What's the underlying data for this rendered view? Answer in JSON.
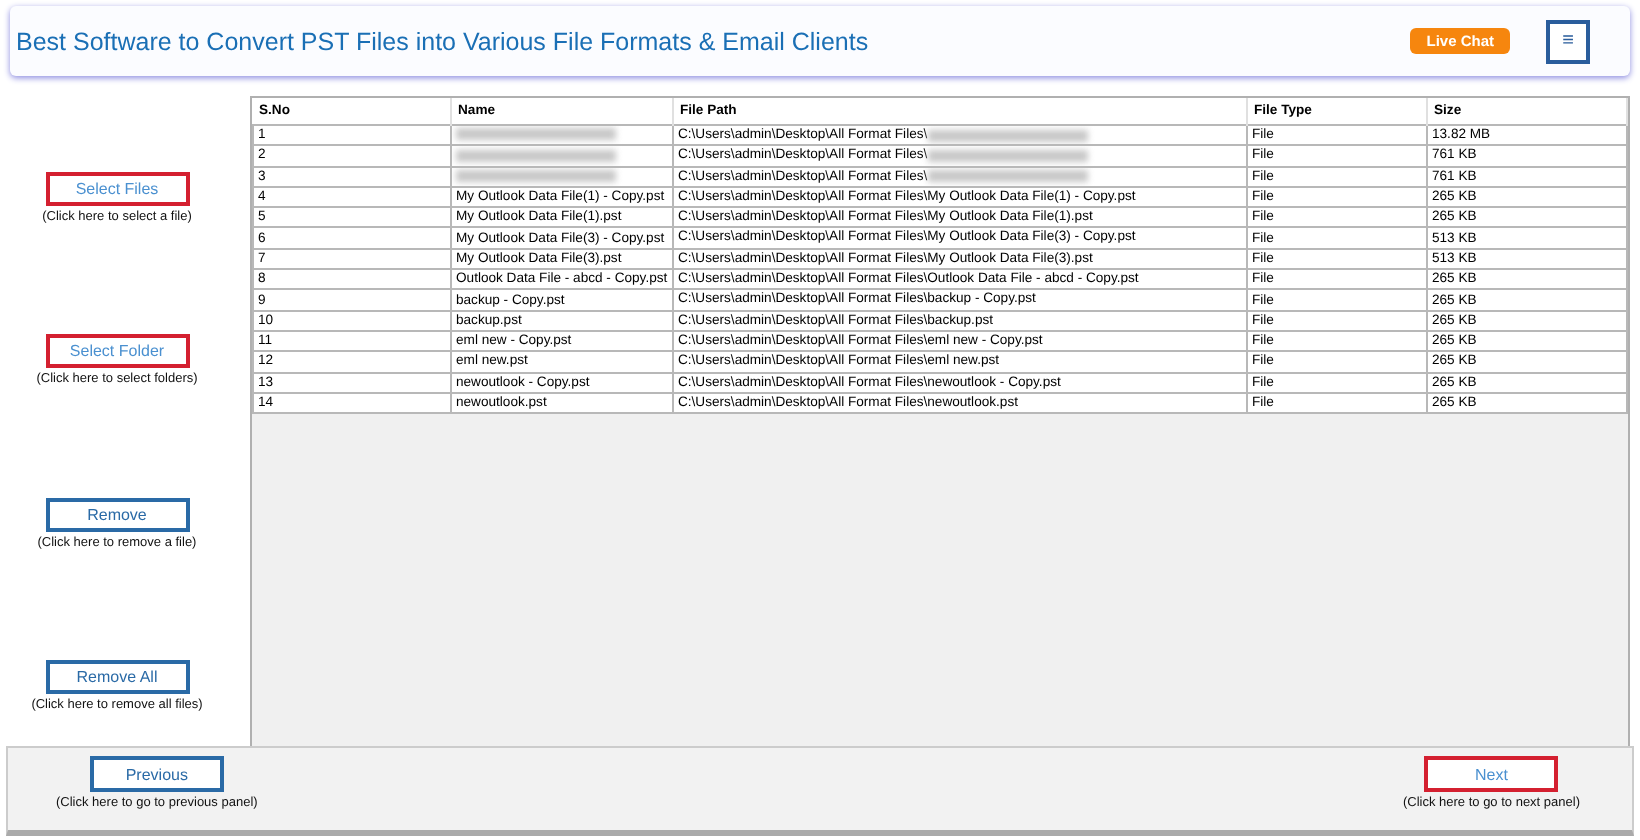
{
  "header": {
    "title": "Best Software to Convert PST Files into Various File Formats & Email Clients",
    "live_chat": "Live Chat",
    "menu": "≡"
  },
  "side_actions": [
    {
      "label": "Select Files",
      "hint": "(Click here to select a file)",
      "highlighted": true
    },
    {
      "label": "Select Folder",
      "hint": "(Click here to select folders)",
      "highlighted": true
    },
    {
      "label": "Remove",
      "hint": "(Click here to remove a file)",
      "highlighted": false
    },
    {
      "label": "Remove All",
      "hint": "(Click here to remove all files)",
      "highlighted": false
    }
  ],
  "table": {
    "columns": [
      "S.No",
      "Name",
      "File Path",
      "File Type",
      "Size"
    ],
    "rows": [
      {
        "sno": "1",
        "path": "C:\\Users\\admin\\Desktop\\All Format Files\\",
        "blurred": true,
        "type": "File",
        "size": "13.82 MB"
      },
      {
        "sno": "2",
        "path": "C:\\Users\\admin\\Desktop\\All Format Files\\",
        "blurred": true,
        "type": "File",
        "size": "761 KB"
      },
      {
        "sno": "3",
        "path": "C:\\Users\\admin\\Desktop\\All Format Files\\",
        "blurred": true,
        "type": "File",
        "size": "761 KB"
      },
      {
        "sno": "4",
        "name": "My Outlook Data File(1) - Copy.pst",
        "path": "C:\\Users\\admin\\Desktop\\All Format Files\\My Outlook Data File(1) - Copy.pst",
        "blurred": false,
        "type": "File",
        "size": "265 KB"
      },
      {
        "sno": "5",
        "name": "My Outlook Data File(1).pst",
        "path": "C:\\Users\\admin\\Desktop\\All Format Files\\My Outlook Data File(1).pst",
        "blurred": false,
        "type": "File",
        "size": "265 KB"
      },
      {
        "sno": "6",
        "name": "My Outlook Data File(3) - Copy.pst",
        "path": "C:\\Users\\admin\\Desktop\\All Format Files\\My Outlook Data File(3) - Copy.pst",
        "blurred": false,
        "type": "File",
        "size": "513 KB"
      },
      {
        "sno": "7",
        "name": "My Outlook Data File(3).pst",
        "path": "C:\\Users\\admin\\Desktop\\All Format Files\\My Outlook Data File(3).pst",
        "blurred": false,
        "type": "File",
        "size": "513 KB"
      },
      {
        "sno": "8",
        "name": "Outlook Data File - abcd - Copy.pst",
        "path": "C:\\Users\\admin\\Desktop\\All Format Files\\Outlook Data File - abcd - Copy.pst",
        "blurred": false,
        "type": "File",
        "size": "265 KB"
      },
      {
        "sno": "9",
        "name": "backup - Copy.pst",
        "path": "C:\\Users\\admin\\Desktop\\All Format Files\\backup - Copy.pst",
        "blurred": false,
        "type": "File",
        "size": "265 KB"
      },
      {
        "sno": "10",
        "name": "backup.pst",
        "path": "C:\\Users\\admin\\Desktop\\All Format Files\\backup.pst",
        "blurred": false,
        "type": "File",
        "size": "265 KB"
      },
      {
        "sno": "11",
        "name": "eml new - Copy.pst",
        "path": "C:\\Users\\admin\\Desktop\\All Format Files\\eml new - Copy.pst",
        "blurred": false,
        "type": "File",
        "size": "265 KB"
      },
      {
        "sno": "12",
        "name": "eml new.pst",
        "path": "C:\\Users\\admin\\Desktop\\All Format Files\\eml new.pst",
        "blurred": false,
        "type": "File",
        "size": "265 KB"
      },
      {
        "sno": "13",
        "name": "newoutlook - Copy.pst",
        "path": "C:\\Users\\admin\\Desktop\\All Format Files\\newoutlook - Copy.pst",
        "blurred": false,
        "type": "File",
        "size": "265 KB"
      },
      {
        "sno": "14",
        "name": "newoutlook.pst",
        "path": "C:\\Users\\admin\\Desktop\\All Format Files\\newoutlook.pst",
        "blurred": false,
        "type": "File",
        "size": "265 KB"
      }
    ]
  },
  "footer": [
    {
      "label": "Previous",
      "hint": "(Click here to go to previous panel)",
      "highlighted": false
    },
    {
      "label": "Next",
      "hint": "(Click here to go to next panel)",
      "highlighted": true
    }
  ]
}
